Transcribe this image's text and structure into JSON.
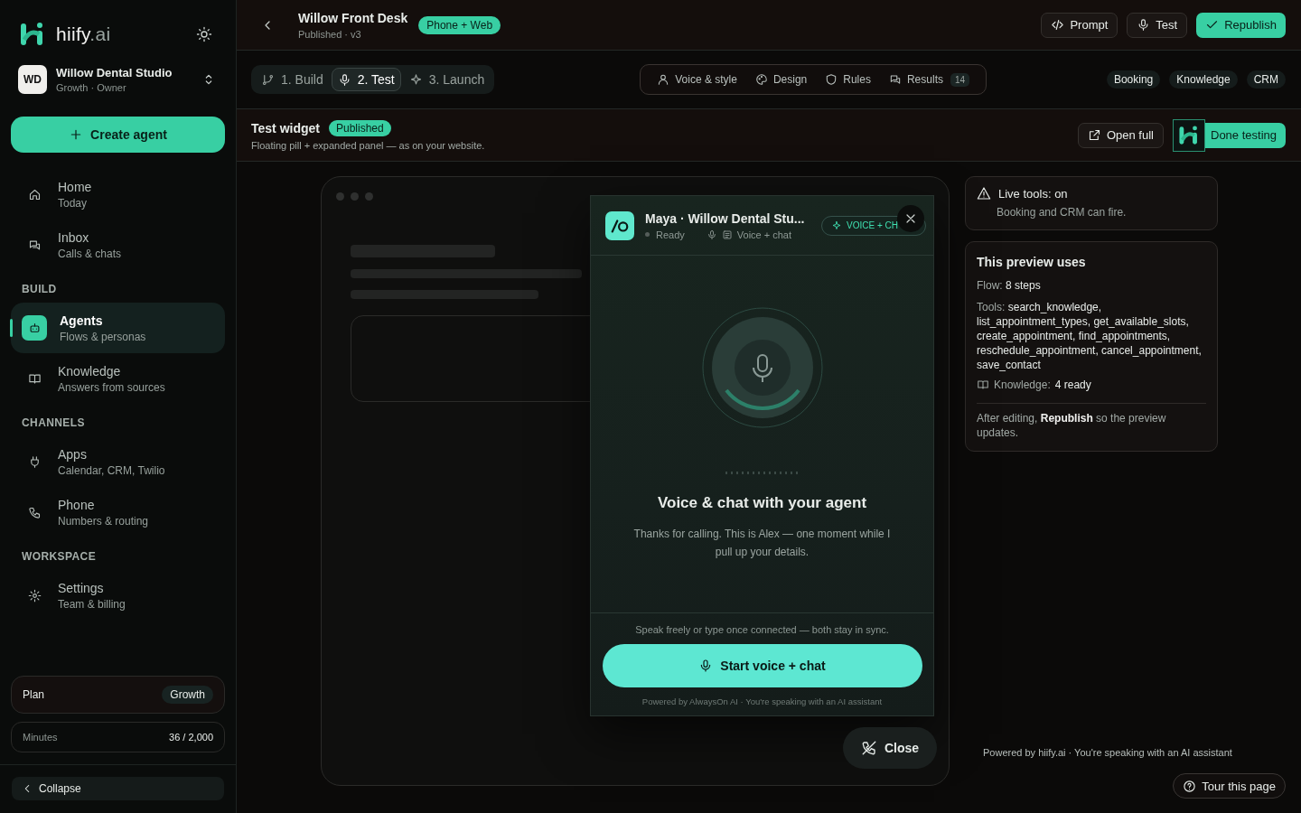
{
  "brand": {
    "name": "hiify",
    "suffix": ".ai"
  },
  "workspace": {
    "initials": "WD",
    "name": "Willow Dental Studio",
    "role": "Growth · Owner"
  },
  "create_button": "Create agent",
  "nav_sections": [
    {
      "items": [
        {
          "label": "Home",
          "sub": "Today",
          "selected": false
        },
        {
          "label": "Inbox",
          "sub": "Calls & chats",
          "selected": false
        }
      ]
    },
    {
      "title": "BUILD",
      "items": [
        {
          "label": "Agents",
          "sub": "Flows & personas",
          "selected": true
        },
        {
          "label": "Knowledge",
          "sub": "Answers from sources",
          "selected": false
        }
      ]
    },
    {
      "title": "CHANNELS",
      "items": [
        {
          "label": "Apps",
          "sub": "Calendar, CRM, Twilio",
          "selected": false
        },
        {
          "label": "Phone",
          "sub": "Numbers & routing",
          "selected": false
        }
      ]
    },
    {
      "title": "WORKSPACE",
      "items": [
        {
          "label": "Settings",
          "sub": "Team & billing",
          "selected": false
        }
      ]
    }
  ],
  "plan": {
    "label": "Plan",
    "value": "Growth"
  },
  "minutes": {
    "label": "Minutes",
    "value": "36 / 2,000"
  },
  "collapse": "Collapse",
  "header": {
    "title": "Willow Front Desk",
    "subtitle": "Published · v3",
    "badge": "Phone + Web",
    "actions": [
      {
        "label": "Prompt",
        "kind": "outline"
      },
      {
        "label": "Test",
        "kind": "outline"
      },
      {
        "label": "Republish",
        "kind": "primary"
      }
    ]
  },
  "steps": [
    {
      "label": "1. Build",
      "selected": false
    },
    {
      "label": "2. Test",
      "selected": true
    },
    {
      "label": "3. Launch",
      "selected": false
    }
  ],
  "config_tabs": [
    {
      "label": "Voice & style"
    },
    {
      "label": "Design"
    },
    {
      "label": "Rules"
    },
    {
      "label": "Results",
      "count": "14"
    }
  ],
  "tags": [
    "Booking",
    "Knowledge",
    "CRM"
  ],
  "section": {
    "title": "Test widget",
    "badge": "Published",
    "subtitle": "Floating pill + expanded panel — as on your website.",
    "open_button": "Open full",
    "done_button": "Done testing"
  },
  "widget": {
    "title": "Maya · Willow Dental Stu...",
    "status": "Ready",
    "mode": "Voice + chat",
    "badge": "VOICE + CH",
    "heading": "Voice & chat with your agent",
    "message": "Thanks for calling. This is Alex — one moment while I pull up your details.",
    "hint": "Speak freely or type once connected — both stay in sync.",
    "start_button": "Start voice + chat",
    "footer": "Powered by AlwaysOn AI · You're speaking with an AI assistant"
  },
  "close_button": "Close",
  "live_tools": {
    "title": "Live tools: on",
    "text": "Booking and CRM can fire."
  },
  "preview": {
    "title": "This preview uses",
    "flow_label": "Flow:",
    "flow_value": "8 steps",
    "tools_label": "Tools:",
    "tools_value": "search_knowledge, list_appointment_types, get_available_slots, create_appointment, find_appointments, reschedule_appointment, cancel_appointment, save_contact",
    "knowledge_label": "Knowledge:",
    "knowledge_value": "4 ready",
    "note": "After editing, **Republish** so the preview updates."
  },
  "powered": "Powered by hiify.ai · You're speaking with an AI assistant",
  "tour_button": "Tour this page"
}
